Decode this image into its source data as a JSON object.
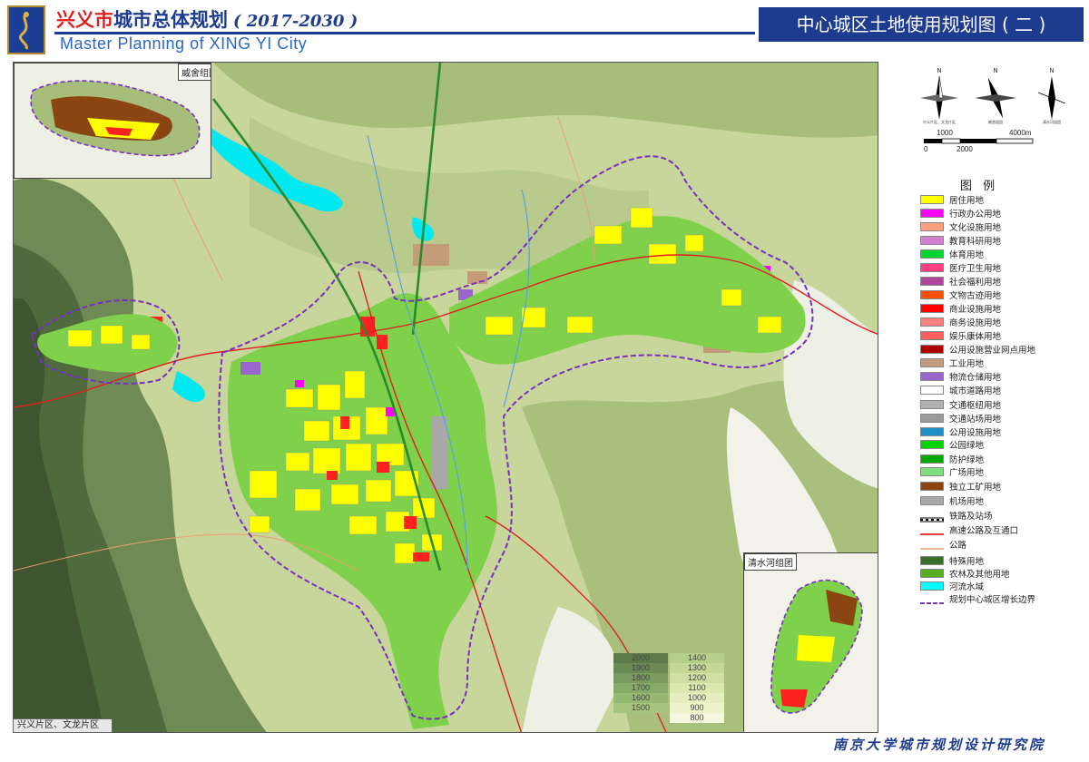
{
  "header": {
    "city": "兴义市",
    "title": "城市总体规划",
    "years": "( 2017-2030 )",
    "english": "Master Planning of XING YI City",
    "sheet_title": "中心城区土地使用规划图 ( 二 )"
  },
  "map": {
    "area_label": "兴义片区、文龙片区",
    "insets": {
      "weijin": "威舍组团",
      "qingshuihe": "清水河组团"
    },
    "elevation": {
      "left": [
        "2000",
        "1900",
        "1800",
        "1700",
        "1600",
        "1500"
      ],
      "right": [
        "1400",
        "1300",
        "1200",
        "1100",
        "1000",
        "900",
        "800"
      ]
    }
  },
  "scale": {
    "ticks_top": [
      "0",
      "1000",
      "4000m"
    ],
    "ticks_bottom": [
      "2000"
    ]
  },
  "legend": {
    "title": "图 例",
    "items": [
      {
        "label": "居住用地",
        "color": "#ffff00",
        "kind": "fill"
      },
      {
        "label": "行政办公用地",
        "color": "#ff00ff",
        "kind": "fill"
      },
      {
        "label": "文化设施用地",
        "color": "#ff9f7f",
        "kind": "fill"
      },
      {
        "label": "教育科研用地",
        "color": "#d27fd2",
        "kind": "fill"
      },
      {
        "label": "体育用地",
        "color": "#00d62f",
        "kind": "fill"
      },
      {
        "label": "医疗卫生用地",
        "color": "#ff3f7f",
        "kind": "fill"
      },
      {
        "label": "社会福利用地",
        "color": "#b0479c",
        "kind": "fill"
      },
      {
        "label": "文物古迹用地",
        "color": "#ff4f00",
        "kind": "fill"
      },
      {
        "label": "商业设施用地",
        "color": "#ff0000",
        "kind": "fill"
      },
      {
        "label": "商务设施用地",
        "color": "#ff8080",
        "kind": "fill"
      },
      {
        "label": "娱乐康体用地",
        "color": "#ff5f5f",
        "kind": "fill"
      },
      {
        "label": "公用设施营业网点用地",
        "color": "#b00000",
        "kind": "fill"
      },
      {
        "label": "工业用地",
        "color": "#c49c7a",
        "kind": "fill"
      },
      {
        "label": "物流仓储用地",
        "color": "#9966cc",
        "kind": "fill"
      },
      {
        "label": "城市道路用地",
        "color": "#ffffff",
        "kind": "fill"
      },
      {
        "label": "交通枢纽用地",
        "color": "#b0b0b0",
        "kind": "fill"
      },
      {
        "label": "交通站场用地",
        "color": "#9a9a9a",
        "kind": "fill"
      },
      {
        "label": "公用设施用地",
        "color": "#1e90c8",
        "kind": "fill"
      },
      {
        "label": "公园绿地",
        "color": "#00d400",
        "kind": "fill"
      },
      {
        "label": "防护绿地",
        "color": "#00a800",
        "kind": "fill"
      },
      {
        "label": "广场用地",
        "color": "#7fe07f",
        "kind": "fill"
      },
      {
        "label": "独立工矿用地",
        "color": "#8b4513",
        "kind": "fill"
      },
      {
        "label": "机场用地",
        "color": "#a8a8a8",
        "kind": "fill"
      },
      {
        "label": "铁路及站场",
        "color": "#000000",
        "kind": "rail"
      },
      {
        "label": "高速公路及互通口",
        "color": "#e00000",
        "kind": "line"
      },
      {
        "label": "公路",
        "color": "#e8a070",
        "kind": "line"
      },
      {
        "label": "特殊用地",
        "color": "#3a6e2a",
        "kind": "fill"
      },
      {
        "label": "农林及其他用地",
        "color": "#58b020",
        "kind": "fill"
      },
      {
        "label": "河流水域",
        "color": "#00ffff",
        "kind": "fill"
      },
      {
        "label": "规划中心城区增长边界",
        "color": "#7a30c0",
        "kind": "dash"
      }
    ]
  },
  "compass": [
    {
      "letter": "N",
      "caption": "兴义片区、文龙片区"
    },
    {
      "letter": "N",
      "caption": "威舍组团"
    },
    {
      "letter": "N",
      "caption": "清水河组团"
    }
  ],
  "footer": {
    "org": "南京大学城市规划设计研究院"
  },
  "colors": {
    "brand_blue": "#1d3b8f",
    "terrain_green": "#b7c98e",
    "boundary_purple": "#7a30c0"
  }
}
